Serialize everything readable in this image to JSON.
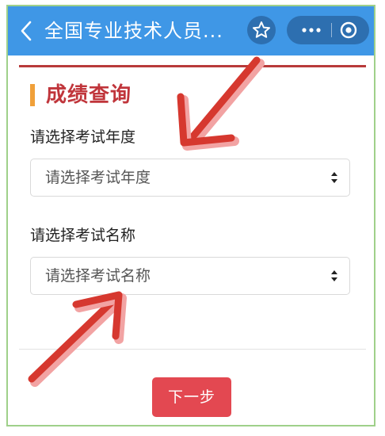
{
  "header": {
    "title": "全国专业技术人员...",
    "color": "#3f97e6"
  },
  "section": {
    "title": "成绩查询",
    "accent": "#c0353b",
    "bar_color": "#f0a03a"
  },
  "form": {
    "year_label": "请选择考试年度",
    "year_select_value": "请选择考试年度",
    "name_label": "请选择考试名称",
    "name_select_value": "请选择考试名称"
  },
  "actions": {
    "next_label": "下一步",
    "next_color": "#e34851"
  },
  "icons": [
    "back-icon",
    "star-icon",
    "more-icon",
    "close-icon",
    "caret-icon"
  ]
}
